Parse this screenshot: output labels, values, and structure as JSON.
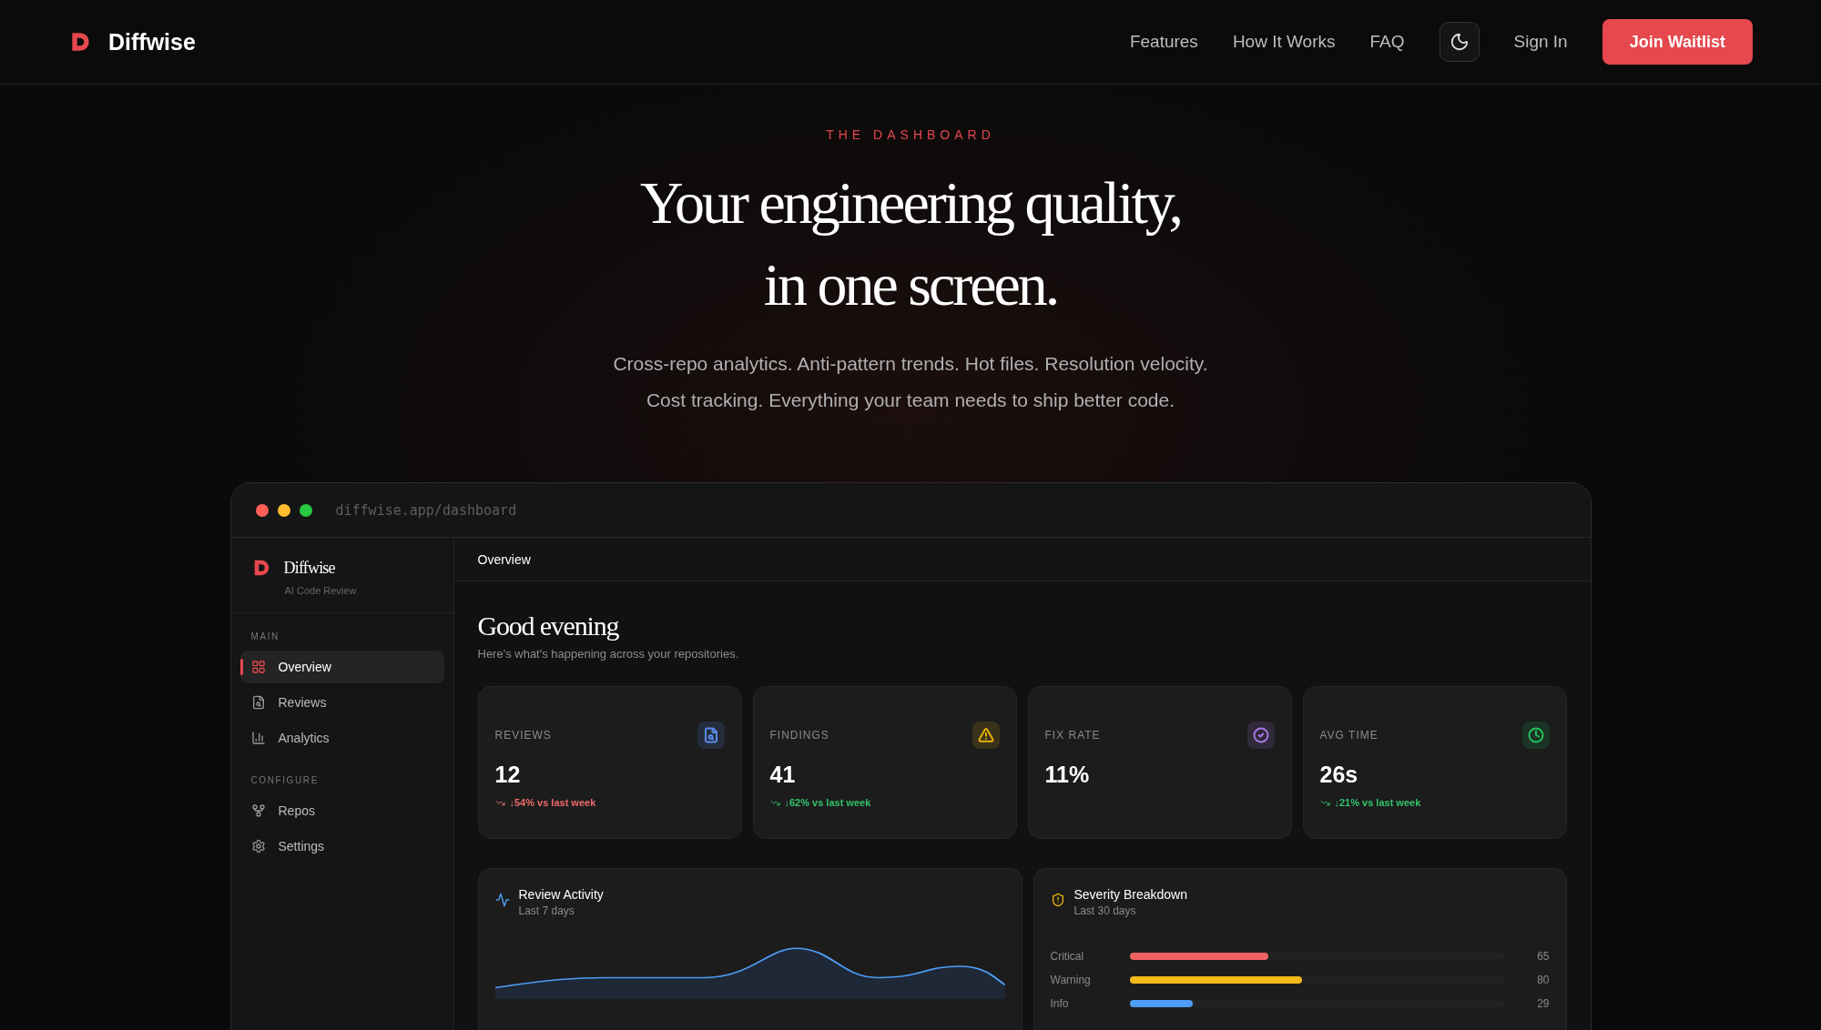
{
  "nav": {
    "brand": "Diffwise",
    "links": [
      "Features",
      "How It Works",
      "FAQ"
    ],
    "sign_in": "Sign In",
    "cta": "Join Waitlist"
  },
  "hero": {
    "kicker": "THE DASHBOARD",
    "headline": [
      "Your engineering quality,",
      "in one screen."
    ],
    "subtitle": [
      "Cross-repo analytics. Anti-pattern trends. Hot files. Resolution velocity.",
      "Cost tracking. Everything your team needs to ship better code."
    ]
  },
  "browser": {
    "url": "diffwise.app/dashboard"
  },
  "sidebar": {
    "brand": "Diffwise",
    "tagline": "AI Code Review",
    "sections": [
      {
        "label": "MAIN",
        "items": [
          {
            "label": "Overview",
            "selected": true
          },
          {
            "label": "Reviews",
            "selected": false
          },
          {
            "label": "Analytics",
            "selected": false
          }
        ]
      },
      {
        "label": "CONFIGURE",
        "items": [
          {
            "label": "Repos",
            "selected": false
          },
          {
            "label": "Settings",
            "selected": false
          }
        ]
      }
    ]
  },
  "topbar": {
    "title": "Overview"
  },
  "greeting": {
    "title": "Good evening",
    "subtitle": "Here's what's happening across your repositories."
  },
  "stats": [
    {
      "label": "REVIEWS",
      "value": "12",
      "change": {
        "text": "↓54% vs last week",
        "color": "#ef6b6b"
      },
      "color": "#5b8def"
    },
    {
      "label": "FINDINGS",
      "value": "41",
      "change": {
        "text": "↓62% vs last week",
        "color": "#34c46e"
      },
      "color": "#eab308"
    },
    {
      "label": "FIX RATE",
      "value": "11%",
      "color": "#a779e9"
    },
    {
      "label": "AVG TIME",
      "value": "26s",
      "change": {
        "text": "↓21% vs last week",
        "color": "#34c46e"
      },
      "color": "#22c55e"
    }
  ],
  "activity": {
    "title": "Review Activity",
    "subtitle": "Last 7 days"
  },
  "severity": {
    "title": "Severity Breakdown",
    "subtitle": "Last 30 days",
    "rows": [
      {
        "label": "Critical",
        "level": 0.37,
        "count": "65",
        "color": "#f06363"
      },
      {
        "label": "Warning",
        "level": 0.46,
        "count": "80",
        "color": "#f5b818"
      },
      {
        "label": "Info",
        "level": 0.17,
        "count": "29",
        "color": "#4e9cf5"
      }
    ]
  }
}
